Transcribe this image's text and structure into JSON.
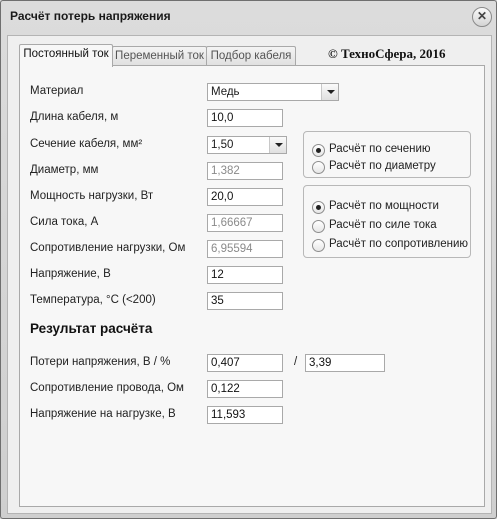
{
  "window": {
    "title": "Расчёт потерь напряжения",
    "close_symbol": "✕"
  },
  "tabs": [
    {
      "label": "Постоянный ток",
      "active": true
    },
    {
      "label": "Переменный ток",
      "active": false
    },
    {
      "label": "Подбор кабеля",
      "active": false
    }
  ],
  "copyright": "© ТехноСфера, 2016",
  "form": {
    "material": {
      "label": "Материал",
      "value": "Медь"
    },
    "length": {
      "label": "Длина кабеля, м",
      "value": "10,0"
    },
    "section": {
      "label": "Сечение кабеля, мм²",
      "value": "1,50"
    },
    "diameter": {
      "label": "Диаметр, мм",
      "value": "1,382"
    },
    "power": {
      "label": "Мощность нагрузки, Вт",
      "value": "20,0"
    },
    "current": {
      "label": "Сила тока, А",
      "value": "1,66667"
    },
    "resistance": {
      "label": "Сопротивление нагрузки, Ом",
      "value": "6,95594"
    },
    "voltage": {
      "label": "Напряжение, В",
      "value": "12"
    },
    "temperature": {
      "label": "Температура, °С (<200)",
      "value": "35"
    }
  },
  "calc_by_group": {
    "options": [
      {
        "label": "Расчёт по сечению",
        "checked": true
      },
      {
        "label": "Расчёт по диаметру",
        "checked": false
      }
    ]
  },
  "calc_mode_group": {
    "options": [
      {
        "label": "Расчёт по мощности",
        "checked": true
      },
      {
        "label": "Расчёт по силе тока",
        "checked": false
      },
      {
        "label": "Расчёт по сопротивлению",
        "checked": false
      }
    ]
  },
  "result": {
    "heading": "Результат расчёта",
    "loss": {
      "label": "Потери напряжения, В / %",
      "volts": "0,407",
      "separator": "/",
      "percent": "3,39"
    },
    "wire_resistance": {
      "label": "Сопротивление провода, Ом",
      "value": "0,122"
    },
    "load_voltage": {
      "label": "Напряжение на нагрузке, В",
      "value": "11,593"
    }
  }
}
